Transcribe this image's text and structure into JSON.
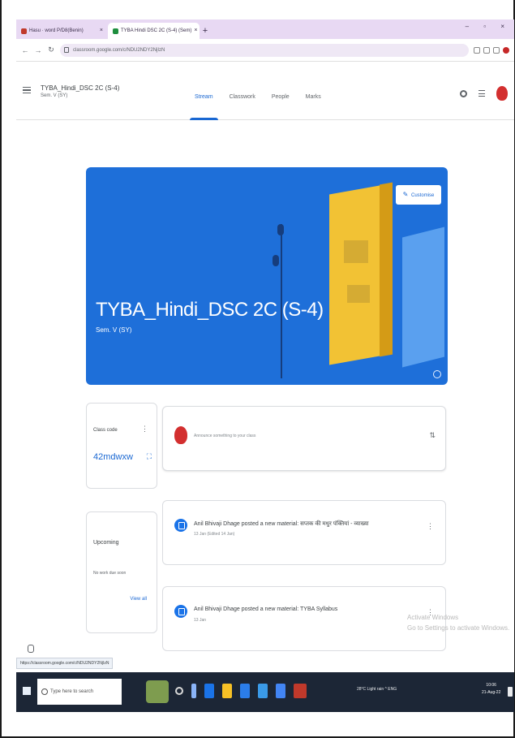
{
  "browser": {
    "tabs": [
      {
        "title": "Hasu · word P/D8(Benin)"
      },
      {
        "title": "TYBA Hindi DSC 2C (S-4) (Sem)"
      }
    ],
    "url": "classroom.google.com/c/NDU2NDY2NjIzN"
  },
  "classroom": {
    "class_title": "TYBA_Hindi_DSC 2C (S-4)",
    "class_subtitle": "Sem. V (SY)",
    "nav_tabs": [
      "Stream",
      "Classwork",
      "People",
      "Marks"
    ],
    "banner": {
      "course_name": "TYBA_Hindi_DSC 2C (S-4)",
      "section": "Sem. V (SY)",
      "customise_label": "Customise"
    },
    "class_code": {
      "label": "Class code",
      "value": "42mdwxw"
    },
    "upcoming": {
      "label": "Upcoming",
      "empty_text": "No work due soon",
      "view_all": "View all"
    },
    "announce_placeholder": "Announce something to your class",
    "posts": [
      {
        "title": "Anil Bhivaji Dhage posted a new material: सप्तक की मधुर पंक्तियां - व्याख्या",
        "date": "13 Jan (Edited 14 Jan)"
      },
      {
        "title": "Anil Bhivaji Dhage posted a new material: TYBA Syllabus",
        "date": "13 Jan"
      }
    ]
  },
  "watermark": {
    "line1": "Activate Windows",
    "line2": "Go to Settings to activate Windows."
  },
  "statusbar_url": "https://classroom.google.com/c/NDU2NDY2NjIzN",
  "taskbar": {
    "search_placeholder": "Type here to search",
    "tray_text": "28°C Light rain  ^  ENG",
    "time": "10:06",
    "date": "21-Aug-22"
  },
  "colors": {
    "banner": "#1e6fd9",
    "accent": "#1967d2",
    "tabstrip": "#e8d9f3",
    "taskbar": "#1c2636"
  }
}
